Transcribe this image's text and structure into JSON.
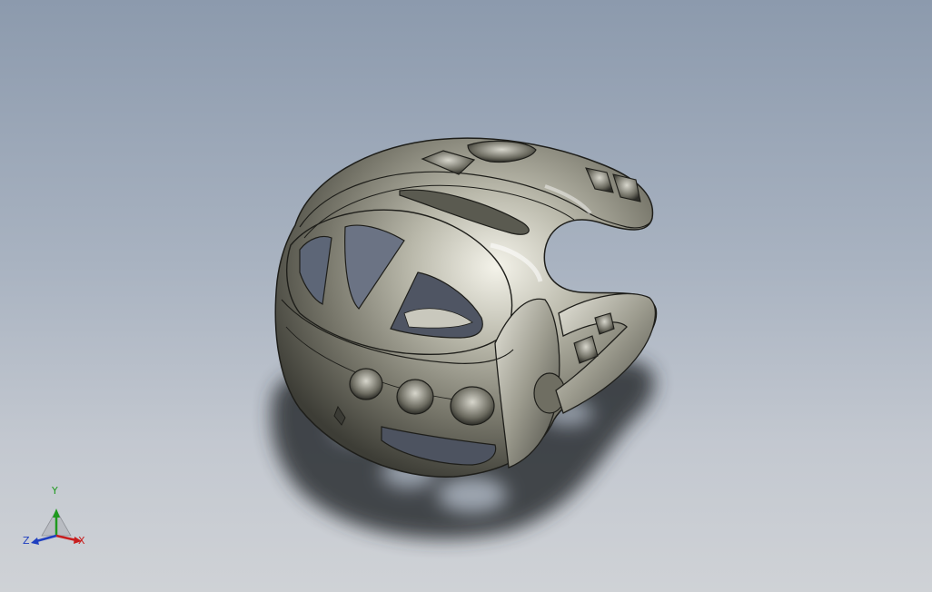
{
  "viewport": {
    "background_top": "#8c9aad",
    "background_bottom": "#cfd2d6"
  },
  "model": {
    "surface_color": "#8b8a7c",
    "highlight_color": "#f4f3ea",
    "edge_color": "#1e1e1a",
    "shadow_color": "#2c2e33"
  },
  "triad": {
    "x_label": "X",
    "y_label": "Y",
    "z_label": "Z",
    "x_color": "#c81e1e",
    "y_color": "#1e9a1e",
    "z_color": "#1f3fbf"
  }
}
